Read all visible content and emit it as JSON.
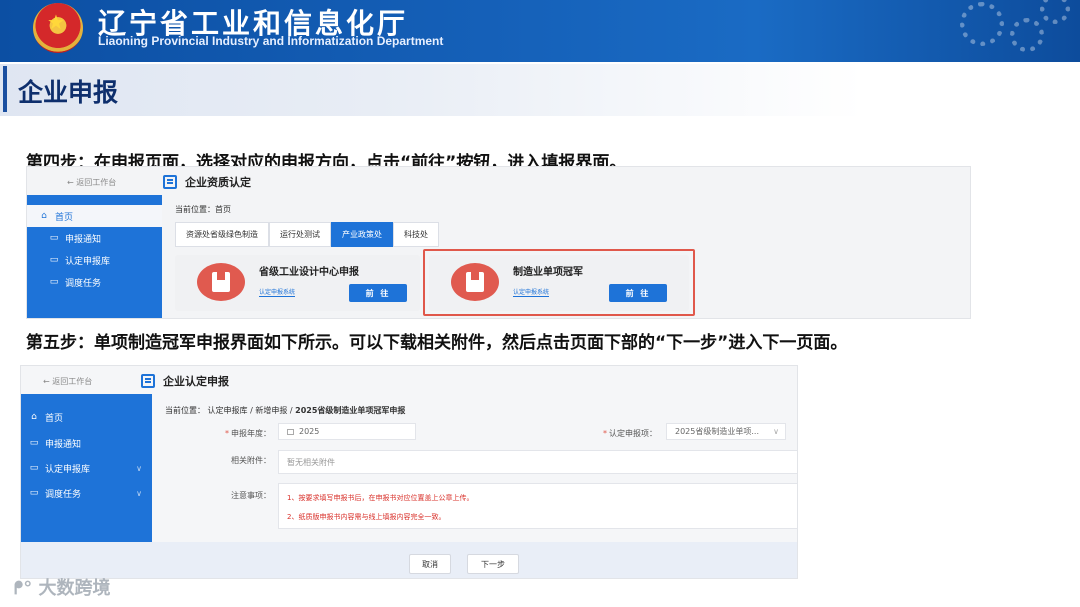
{
  "banner": {
    "title": "辽宁省工业和信息化厅",
    "subtitle": "Liaoning Provincial Industry and Informatization Department"
  },
  "section": {
    "title": "企业申报"
  },
  "steps": {
    "step4": "第四步：在申报页面，选择对应的申报方向，点击“前往”按钮，进入填报界面。",
    "step5": "第五步：单项制造冠军申报界面如下所示。可以下载相关附件，然后点击页面下部的“下一步”进入下一页面。"
  },
  "shot1": {
    "back_label": "← 返回工作台",
    "page_title": "企业资质认定",
    "sidebar": [
      {
        "label": "首页"
      },
      {
        "label": "申报通知"
      },
      {
        "label": "认定申报库"
      },
      {
        "label": "调度任务"
      }
    ],
    "breadcrumb": "当前位置：首页",
    "tabs": [
      "资源处省级绿色制造",
      "运行处测试",
      "产业政策处",
      "科技处"
    ],
    "active_tab": "产业政策处",
    "cards": [
      {
        "name": "省级工业设计中心申报",
        "link": "认定申报系统",
        "button": "前 往"
      },
      {
        "name": "制造业单项冠军",
        "link": "认定申报系统",
        "button": "前 往"
      }
    ]
  },
  "shot2": {
    "back_label": "← 返回工作台",
    "page_title": "企业认定申报",
    "sidebar": [
      {
        "label": "首页"
      },
      {
        "label": "申报通知"
      },
      {
        "label": "认定申报库"
      },
      {
        "label": "调度任务"
      }
    ],
    "breadcrumb": {
      "prefix": "当前位置：",
      "items": [
        "认定申报库",
        "新增申报"
      ],
      "current": "2025省级制造业单项冠军申报"
    },
    "fields": {
      "year_label": "申报年度：",
      "year_value": "2025",
      "item_label": "认定申报项：",
      "item_value": "2025省级制造业单项...",
      "attach_label": "相关附件：",
      "attach_value": "暂无相关附件",
      "notes_label": "注意事项："
    },
    "notes": [
      "1、按要求填写申报书后，在申报书对应位置盖上公章上传。",
      "2、纸质版申报书内容需与线上填报内容完全一致。"
    ],
    "buttons": {
      "cancel": "取消",
      "next": "下一步"
    }
  },
  "watermark": "大数跨境",
  "colors": {
    "brand_blue": "#1e73d8",
    "banner_blue": "#1560b8",
    "highlight_red": "#e0584b",
    "card_red": "#e05a4f"
  }
}
